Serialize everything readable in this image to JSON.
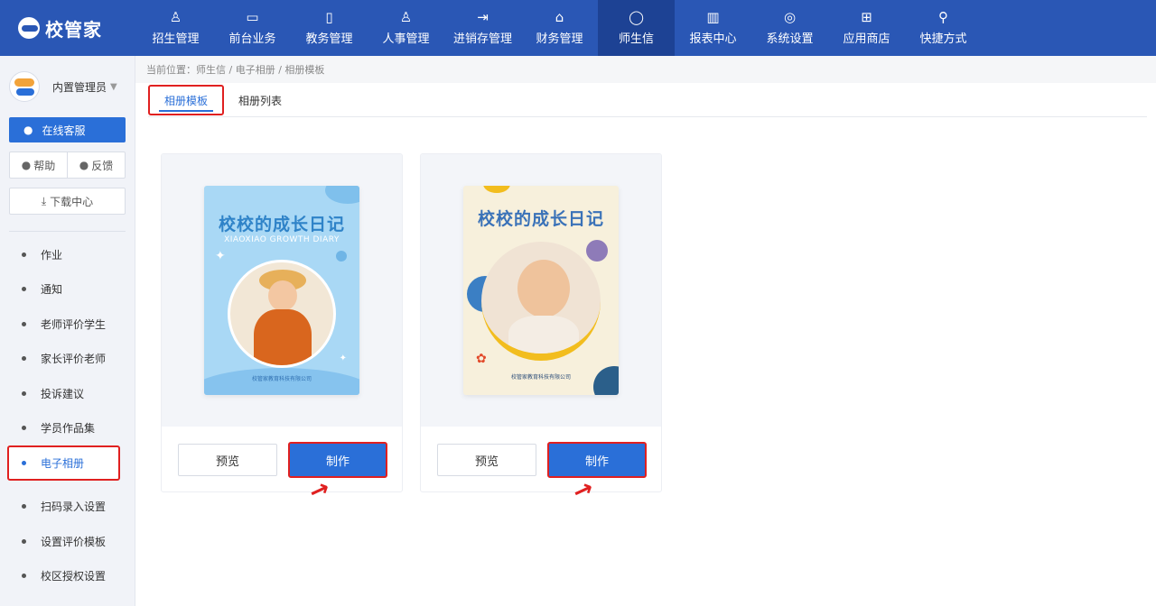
{
  "app": {
    "logo_text": "校管家"
  },
  "nav": [
    {
      "icon": "♙",
      "label": "招生管理"
    },
    {
      "icon": "▭",
      "label": "前台业务"
    },
    {
      "icon": "▯",
      "label": "教务管理"
    },
    {
      "icon": "♙",
      "label": "人事管理"
    },
    {
      "icon": "⇥",
      "label": "进销存管理"
    },
    {
      "icon": "⌂",
      "label": "财务管理"
    },
    {
      "icon": "◯",
      "label": "师生信"
    },
    {
      "icon": "▥",
      "label": "报表中心"
    },
    {
      "icon": "◎",
      "label": "系统设置"
    },
    {
      "icon": "⊞",
      "label": "应用商店"
    },
    {
      "icon": "⚲",
      "label": "快捷方式"
    }
  ],
  "sidebar": {
    "user_name": "内置管理员",
    "service_label": "在线客服",
    "help_label": "帮助",
    "feedback_label": "反馈",
    "download_label": "下载中心",
    "menu": [
      "作业",
      "通知",
      "老师评价学生",
      "家长评价老师",
      "投诉建议",
      "学员作品集",
      "电子相册",
      "扫码录入设置",
      "设置评价模板",
      "校区授权设置"
    ]
  },
  "breadcrumb": "当前位置：师生信 / 电子相册 / 相册模板",
  "tabs": [
    "相册模板",
    "相册列表"
  ],
  "templates": [
    {
      "title": "校校的成长日记",
      "subtitle": "XIAOXIAO GROWTH DIARY",
      "footer": "校管家教育科技有限公司",
      "preview_label": "预览",
      "make_label": "制作"
    },
    {
      "title": "校校的成长日记",
      "footer": "校管家教育科技有限公司",
      "preview_label": "预览",
      "make_label": "制作"
    }
  ],
  "colors": {
    "primary": "#2a6fd8",
    "topbar": "#2a57b5",
    "highlight": "#e02020"
  }
}
